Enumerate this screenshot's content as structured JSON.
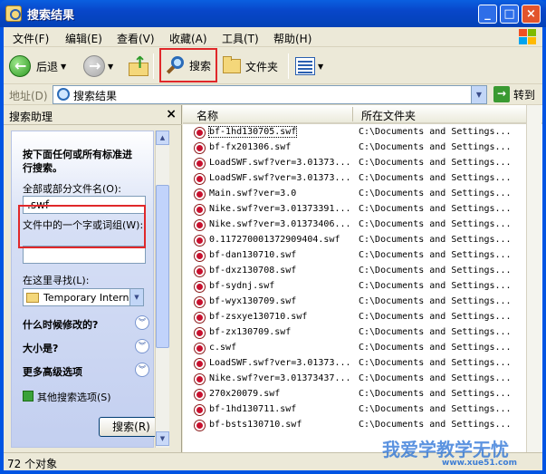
{
  "window": {
    "title": "搜索结果"
  },
  "menubar": [
    "文件(F)",
    "编辑(E)",
    "查看(V)",
    "收藏(A)",
    "工具(T)",
    "帮助(H)"
  ],
  "toolbar": {
    "back_label": "后退",
    "search_label": "搜索",
    "folders_label": "文件夹"
  },
  "address": {
    "label": "地址(D)",
    "value": "搜索结果",
    "go_label": "转到"
  },
  "search_pane": {
    "title": "搜索助理",
    "heading": "按下面任何或所有标准进行搜索。",
    "filename_label": "全部或部分文件名(O):",
    "filename_value": ".swf",
    "word_label": "文件中的一个字或词组(W):",
    "word_value": "",
    "lookin_label": "在这里寻找(L):",
    "lookin_value": "Temporary Interne",
    "when_modified": "什么时候修改的?",
    "size": "大小是?",
    "advanced": "更多高级选项",
    "other": "其他搜索选项(S)",
    "search_button": "搜索(R)"
  },
  "columns": {
    "name": "名称",
    "location": "所在文件夹"
  },
  "files": [
    {
      "name": "bf-1hd130705.swf",
      "location": "C:\\Documents and Settings..."
    },
    {
      "name": "bf-fx201306.swf",
      "location": "C:\\Documents and Settings..."
    },
    {
      "name": "LoadSWF.swf?ver=3.01373...",
      "location": "C:\\Documents and Settings..."
    },
    {
      "name": "LoadSWF.swf?ver=3.01373...",
      "location": "C:\\Documents and Settings..."
    },
    {
      "name": "Main.swf?ver=3.0",
      "location": "C:\\Documents and Settings..."
    },
    {
      "name": "Nike.swf?ver=3.01373391...",
      "location": "C:\\Documents and Settings..."
    },
    {
      "name": "Nike.swf?ver=3.01373406...",
      "location": "C:\\Documents and Settings..."
    },
    {
      "name": "0.117270001372909404.swf",
      "location": "C:\\Documents and Settings..."
    },
    {
      "name": "bf-dan130710.swf",
      "location": "C:\\Documents and Settings..."
    },
    {
      "name": "bf-dxz130708.swf",
      "location": "C:\\Documents and Settings..."
    },
    {
      "name": "bf-sydnj.swf",
      "location": "C:\\Documents and Settings..."
    },
    {
      "name": "bf-wyx130709.swf",
      "location": "C:\\Documents and Settings..."
    },
    {
      "name": "bf-zsxye130710.swf",
      "location": "C:\\Documents and Settings..."
    },
    {
      "name": "bf-zx130709.swf",
      "location": "C:\\Documents and Settings..."
    },
    {
      "name": "c.swf",
      "location": "C:\\Documents and Settings..."
    },
    {
      "name": "LoadSWF.swf?ver=3.01373...",
      "location": "C:\\Documents and Settings..."
    },
    {
      "name": "Nike.swf?ver=3.01373437...",
      "location": "C:\\Documents and Settings..."
    },
    {
      "name": "270x20079.swf",
      "location": "C:\\Documents and Settings..."
    },
    {
      "name": "bf-1hd130711.swf",
      "location": "C:\\Documents and Settings..."
    },
    {
      "name": "bf-bsts130710.swf",
      "location": "C:\\Documents and Settings..."
    }
  ],
  "status": {
    "count_text": "72 个对象"
  },
  "watermark": {
    "text": "我爱学教学无忧",
    "url": "www.xue51.com"
  },
  "colors": {
    "title_blue": "#0054e3",
    "highlight_red": "#e0282a",
    "xp_beige": "#ece9d8"
  }
}
